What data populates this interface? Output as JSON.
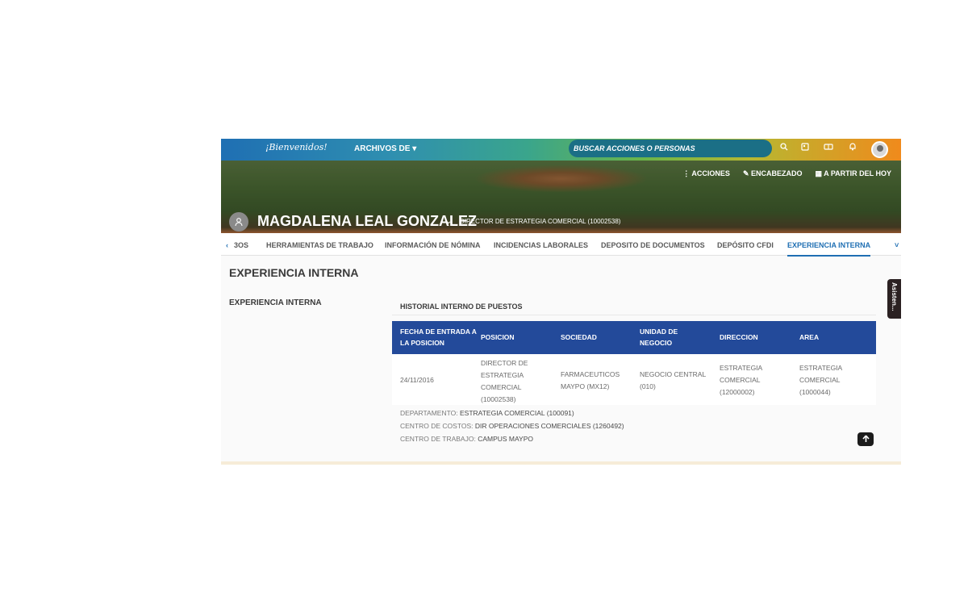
{
  "topbar": {
    "logo": "¡Bienvenidos!",
    "archivos": "ARCHIVOS DE ▾",
    "search_placeholder": "BUSCAR ACCIONES O PERSONAS",
    "icons": [
      "search-icon",
      "id-card-icon",
      "contacts-icon",
      "bell-icon"
    ]
  },
  "hero": {
    "actions": [
      "⋮ ACCIONES",
      "✎ ENCABEZADO",
      "▦ A PARTIR DEL HOY"
    ],
    "name": "MAGDALENA LEAL GONZALEZ",
    "role": "DIRECTOR DE ESTRATEGIA COMERCIAL (10002538)"
  },
  "tabs": {
    "prev": "‹",
    "items": [
      "3OS",
      "HERRAMIENTAS DE TRABAJO",
      "INFORMACIÓN DE NÓMINA",
      "INCIDENCIAS LABORALES",
      "DEPOSITO DE DOCUMENTOS",
      "DEPÓSITO CFDI",
      "EXPERIENCIA INTERNA"
    ],
    "more": "˅"
  },
  "main": {
    "title": "EXPERIENCIA INTERNA",
    "side_label": "EXPERIENCIA INTERNA",
    "history_title": "HISTORIAL INTERNO DE PUESTOS",
    "table": {
      "headers": [
        "FECHA DE ENTRADA A LA POSICION",
        "POSICION",
        "SOCIEDAD",
        "UNIDAD DE NEGOCIO",
        "DIRECCION",
        "AREA"
      ],
      "row": [
        "24/11/2016",
        "DIRECTOR DE ESTRATEGIA COMERCIAL (10002538)",
        "FARMACEUTICOS MAYPO (MX12)",
        "NEGOCIO CENTRAL (010)",
        "ESTRATEGIA COMERCIAL (12000002)",
        "ESTRATEGIA COMERCIAL (1000044)"
      ]
    },
    "details": [
      {
        "label": "DEPARTAMENTO:",
        "value": "ESTRATEGIA COMERCIAL (100091)"
      },
      {
        "label": "CENTRO DE COSTOS:",
        "value": "DIR OPERACIONES COMERCIALES (1260492)"
      },
      {
        "label": "CENTRO DE TRABAJO:",
        "value": "CAMPUS MAYPO"
      }
    ]
  },
  "assistant": "Asisten..."
}
